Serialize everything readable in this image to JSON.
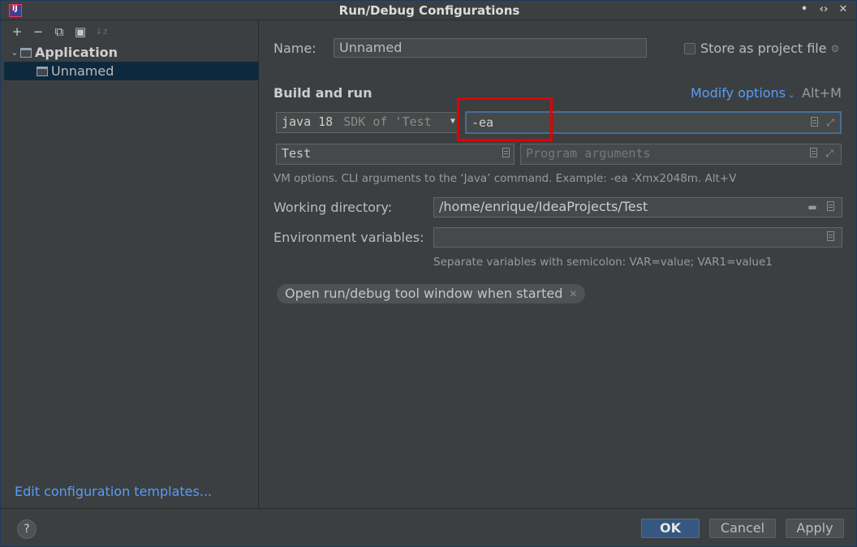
{
  "window": {
    "title": "Run/Debug Configurations"
  },
  "app_icon_label": "IJ",
  "icons": {
    "minimize": "minimize-icon",
    "restore": "restore-icon",
    "close": "close-icon",
    "add": "plus-icon",
    "remove": "minus-icon",
    "copy": "copy-icon",
    "folder": "folder-add-icon",
    "sort": "sort-icon"
  },
  "toolbar": {
    "add": "+",
    "remove": "−",
    "copy": "⧉",
    "folder": "▣",
    "sort": "↓z"
  },
  "tree": {
    "group_label": "Application",
    "item_label": "Unnamed"
  },
  "left_footer": {
    "edit_templates": "Edit configuration templates..."
  },
  "form": {
    "name_label": "Name:",
    "name_value": "Unnamed",
    "store_label": "Store as project file",
    "section_title": "Build and run",
    "modify_options": "Modify options",
    "modify_shortcut": "Alt+M",
    "jre_value": "java 18",
    "jre_sdk_hint": "SDK of 'Test",
    "vm_options_value": "-ea",
    "main_class_value": "Test",
    "program_args_placeholder": "Program arguments",
    "vm_hint": "VM options. CLI arguments to the ‘Java’ command. Example: -ea -Xmx2048m. Alt+V",
    "working_dir_label": "Working directory:",
    "working_dir_value": "/home/enrique/IdeaProjects/Test",
    "env_label": "Environment variables:",
    "env_value": "",
    "env_hint": "Separate variables with semicolon: VAR=value; VAR1=value1",
    "chip_label": "Open run/debug tool window when started"
  },
  "buttons": {
    "help": "?",
    "ok": "OK",
    "cancel": "Cancel",
    "apply": "Apply"
  },
  "colors": {
    "accent": "#589df6",
    "highlight": "#e00000",
    "primary_button": "#365880"
  }
}
